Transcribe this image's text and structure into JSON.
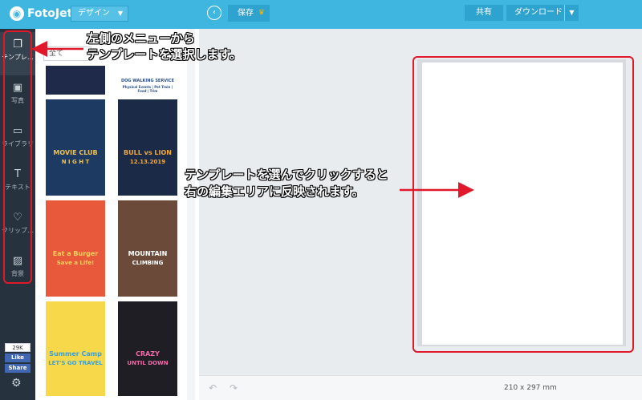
{
  "topbar": {
    "logo_text": "FotoJet",
    "design_menu": "デザイン",
    "save_label": "保存",
    "share_label": "共有",
    "download_label": "ダウンロード"
  },
  "rail": {
    "items": [
      {
        "label": "テンプレ…",
        "icon": "template-icon"
      },
      {
        "label": "写真",
        "icon": "photo-icon"
      },
      {
        "label": "ライブラリ",
        "icon": "library-icon"
      },
      {
        "label": "テキスト",
        "icon": "text-icon"
      },
      {
        "label": "クリップ…",
        "icon": "clipart-icon"
      },
      {
        "label": "背景",
        "icon": "background-icon"
      }
    ],
    "fb_count": "29K",
    "fb_like": "Like",
    "fb_share": "Share"
  },
  "panel": {
    "filter": "全て",
    "templates": [
      {
        "t1": "",
        "t2": "",
        "bg": "#1f2a4a",
        "accent": "#5ab7e8"
      },
      {
        "t1": "DOG WALKING SERVICE",
        "t2": "Physical Events | Pet Train | Food | Trim",
        "bg": "#ffffff",
        "accent": "#2a4f8a"
      },
      {
        "t1": "MOVIE CLUB",
        "t2": "N I G H T",
        "bg": "#1d3a63",
        "accent": "#f2c14e"
      },
      {
        "t1": "BULL vs LION",
        "t2": "12.13.2019",
        "bg": "#1b2b47",
        "accent": "#f2a93b"
      },
      {
        "t1": "Eat a Burger",
        "t2": "Save a Life!",
        "bg": "#e8583a",
        "accent": "#f7d25c"
      },
      {
        "t1": "MOUNTAIN",
        "t2": "CLIMBING",
        "bg": "#6b4a3a",
        "accent": "#ffffff"
      },
      {
        "t1": "Summer Camp",
        "t2": "LET'S GO TRAVEL",
        "bg": "#f6d84a",
        "accent": "#3aa0d8"
      },
      {
        "t1": "CRAZY",
        "t2": "UNTIL DOWN",
        "bg": "#1e1e24",
        "accent": "#f06aa8"
      }
    ]
  },
  "canvas": {
    "size": "210 x 297 mm"
  },
  "annotations": {
    "left_line1": "左側のメニューから",
    "left_line2": "テンプレートを選択します。",
    "right_line1": "テンプレートを選んでクリックすると",
    "right_line2": "右の編集エリアに反映されます。"
  },
  "colors": {
    "topbar": "#3fb6e0",
    "rail": "#26323e",
    "annotation_red": "#e0182a"
  }
}
